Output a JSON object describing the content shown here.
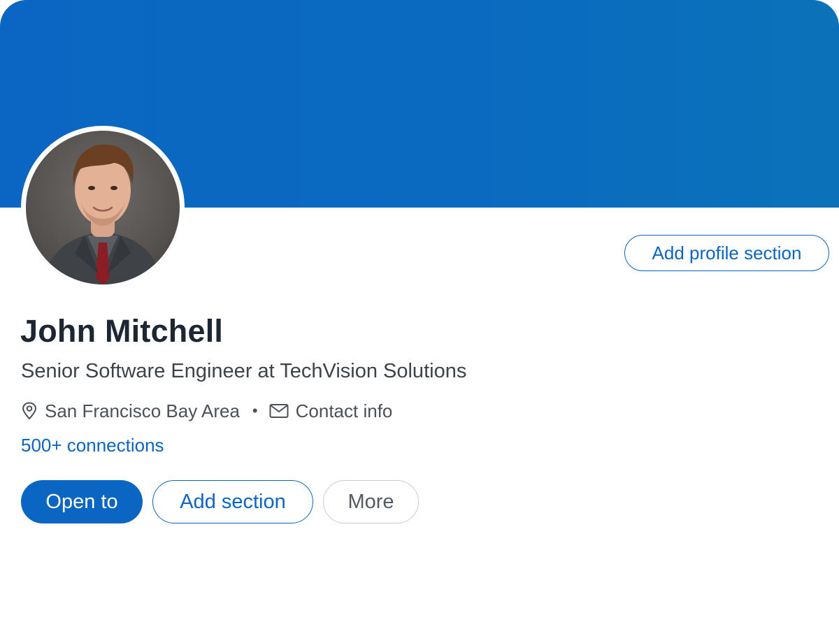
{
  "profile": {
    "name": "John Mitchell",
    "headline": "Senior Software Engineer at TechVision Solutions",
    "location": "San Francisco Bay Area",
    "separator": "•",
    "contact_label": "Contact info",
    "connections": "500+ connections"
  },
  "actions": {
    "add_profile_section": "Add profile section",
    "open_to": "Open to",
    "add_section": "Add section",
    "more": "More"
  },
  "icons": {
    "location": "map-pin-icon",
    "contact": "envelope-icon"
  },
  "colors": {
    "brand": "#0a66c2",
    "banner": "#0a66c2",
    "text_primary": "#1d2733",
    "text_secondary": "#3c434a"
  }
}
